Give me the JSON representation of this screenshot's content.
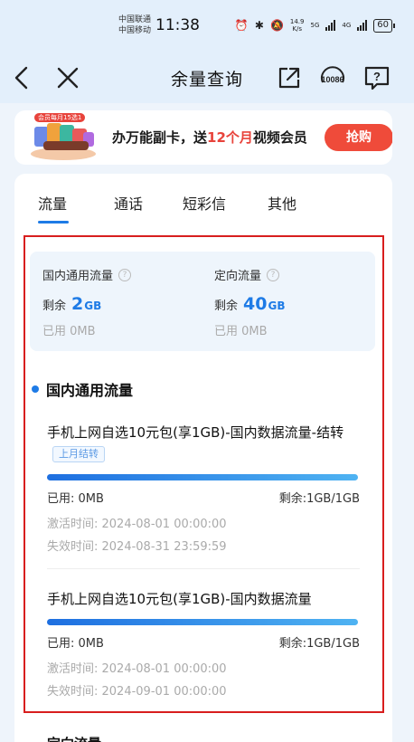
{
  "status_bar": {
    "carrier1": "中国联通",
    "carrier2": "中国移动",
    "time": "11:38",
    "net_speed": "14.9",
    "net_unit": "K/s",
    "net5g": "5G",
    "net4g": "4G",
    "battery": "60"
  },
  "nav": {
    "title": "余量查询",
    "service_number": "10086"
  },
  "banner": {
    "tag": "会员每月15选1",
    "text_pre": "办万能副卡，送",
    "text_highlight": "12个月",
    "text_post": "视频会员",
    "button": "抢购"
  },
  "tabs": [
    {
      "label": "流量",
      "active": true
    },
    {
      "label": "通话",
      "active": false
    },
    {
      "label": "短彩信",
      "active": false
    },
    {
      "label": "其他",
      "active": false
    }
  ],
  "summary": {
    "domestic": {
      "label": "国内通用流量",
      "remain_label": "剩余",
      "remain_value": "2",
      "remain_unit": "GB",
      "used": "已用  0MB"
    },
    "directed": {
      "label": "定向流量",
      "remain_label": "剩余",
      "remain_value": "40",
      "remain_unit": "GB",
      "used": "已用  0MB"
    }
  },
  "section_title": "国内通用流量",
  "packages": [
    {
      "title": "手机上网自选10元包(享1GB)-国内数据流量-结转",
      "badge": "上月结转",
      "used": "已用: 0MB",
      "remain": "剩余:1GB/1GB",
      "remain_fraction": 1.0,
      "activated": "激活时间: 2024-08-01 00:00:00",
      "expires": "失效时间: 2024-08-31 23:59:59"
    },
    {
      "title": "手机上网自选10元包(享1GB)-国内数据流量",
      "badge": "",
      "used": "已用: 0MB",
      "remain": "剩余:1GB/1GB",
      "remain_fraction": 1.0,
      "activated": "激活时间: 2024-08-01 00:00:00",
      "expires": "失效时间: 2024-09-01 00:00:00"
    }
  ],
  "next_section_peek": "定向流量",
  "colors": {
    "accent": "#1e7be6",
    "promo": "#ef4b3a",
    "highlight_frame": "#d81e1e"
  }
}
